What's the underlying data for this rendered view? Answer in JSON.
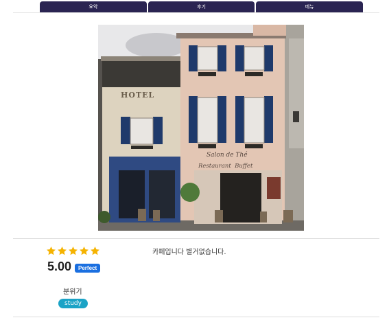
{
  "tabs": [
    {
      "label": "요약"
    },
    {
      "label": "후기"
    },
    {
      "label": "메뉴"
    }
  ],
  "photo": {
    "sign_hotel": "HOTEL",
    "sign_salon": "Salon de Thé",
    "sign_restaurant": "Restaurant  Buffet"
  },
  "review": {
    "stars": 5,
    "score": "5.00",
    "badge": "Perfect",
    "mood_label": "분위기",
    "mood_tag": "study",
    "text": "카페입니다 별거없습니다."
  },
  "colors": {
    "tab_bg": "#2a2452",
    "star": "#f5b301",
    "badge_bg": "#1a6fe0",
    "pill_bg": "#1ba3c6"
  }
}
